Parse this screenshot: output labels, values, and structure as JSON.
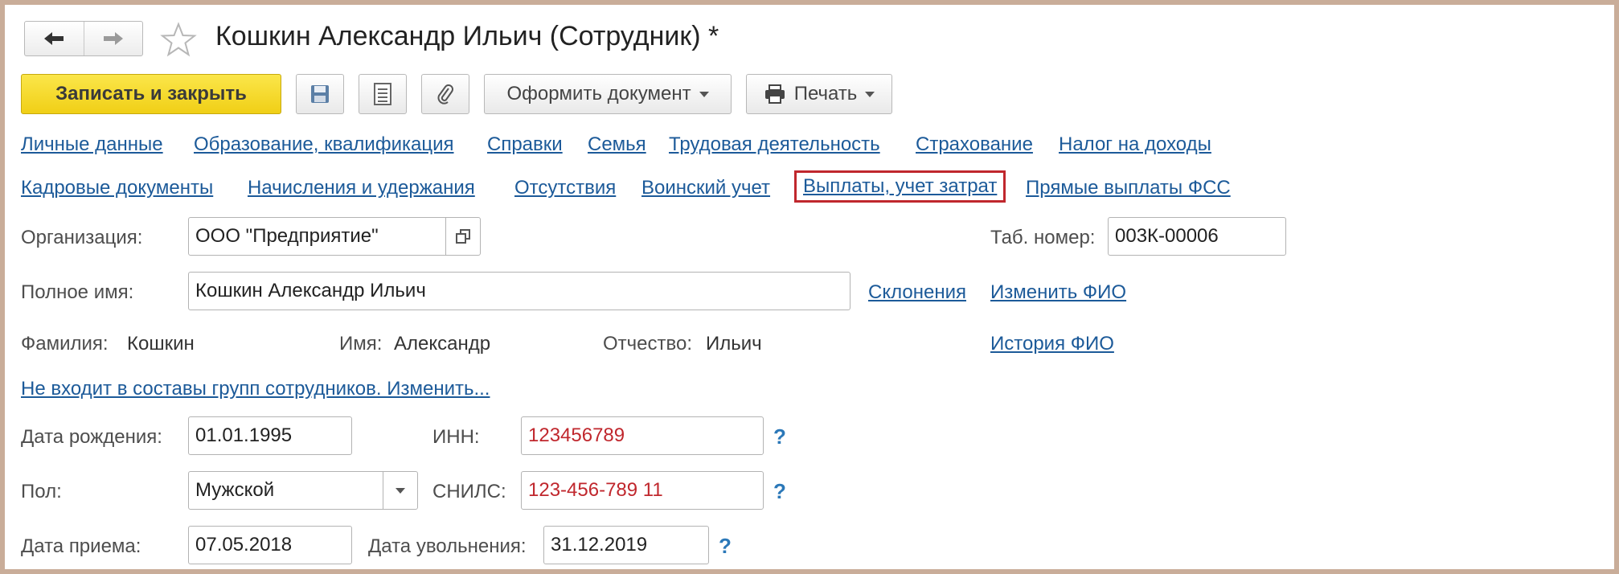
{
  "window": {
    "title": "Кошкин Александр Ильич (Сотрудник) *",
    "back_icon": "arrow-left-icon",
    "forward_icon": "arrow-right-icon",
    "favorite_icon": "star-icon"
  },
  "toolbar": {
    "save_close_label": "Записать и закрыть",
    "save_icon": "floppy-disk-icon",
    "list_icon": "document-list-icon",
    "attach_icon": "paperclip-icon",
    "create_doc_label": "Оформить документ",
    "print_label": "Печать",
    "print_icon": "printer-icon"
  },
  "links_row1": [
    "Личные данные",
    "Образование, квалификация",
    "Справки",
    "Семья",
    "Трудовая деятельность",
    "Страхование",
    "Налог на доходы"
  ],
  "links_row2": [
    "Кадровые документы",
    "Начисления и удержания",
    "Отсутствия",
    "Воинский учет",
    "Выплаты, учет затрат",
    "Прямые выплаты ФСС"
  ],
  "highlight_color": "#c0272d",
  "link_color": "#1c5a99",
  "form": {
    "organization_label": "Организация:",
    "organization_value": "ООО \"Предприятие\"",
    "tab_number_label": "Таб. номер:",
    "tab_number_value": "003К-00006",
    "full_name_label": "Полное имя:",
    "full_name_value": "Кошкин Александр Ильич",
    "declensions_link": "Склонения",
    "change_name_link": "Изменить ФИО",
    "surname_label": "Фамилия:",
    "surname_value": "Кошкин",
    "first_name_label": "Имя:",
    "first_name_value": "Александр",
    "patronymic_label": "Отчество:",
    "patronymic_value": "Ильич",
    "name_history_link": "История ФИО",
    "groups_link": "Не входит в составы групп сотрудников. Изменить...",
    "birth_date_label": "Дата рождения:",
    "birth_date_value": "01.01.1995",
    "inn_label": "ИНН:",
    "inn_value": "123456789",
    "gender_label": "Пол:",
    "gender_value": "Мужской",
    "snils_label": "СНИЛС:",
    "snils_value": "123-456-789 11",
    "hire_date_label": "Дата приема:",
    "hire_date_value": "07.05.2018",
    "dismissal_date_label": "Дата увольнения:",
    "dismissal_date_value": "31.12.2019",
    "help_mark": "?"
  }
}
